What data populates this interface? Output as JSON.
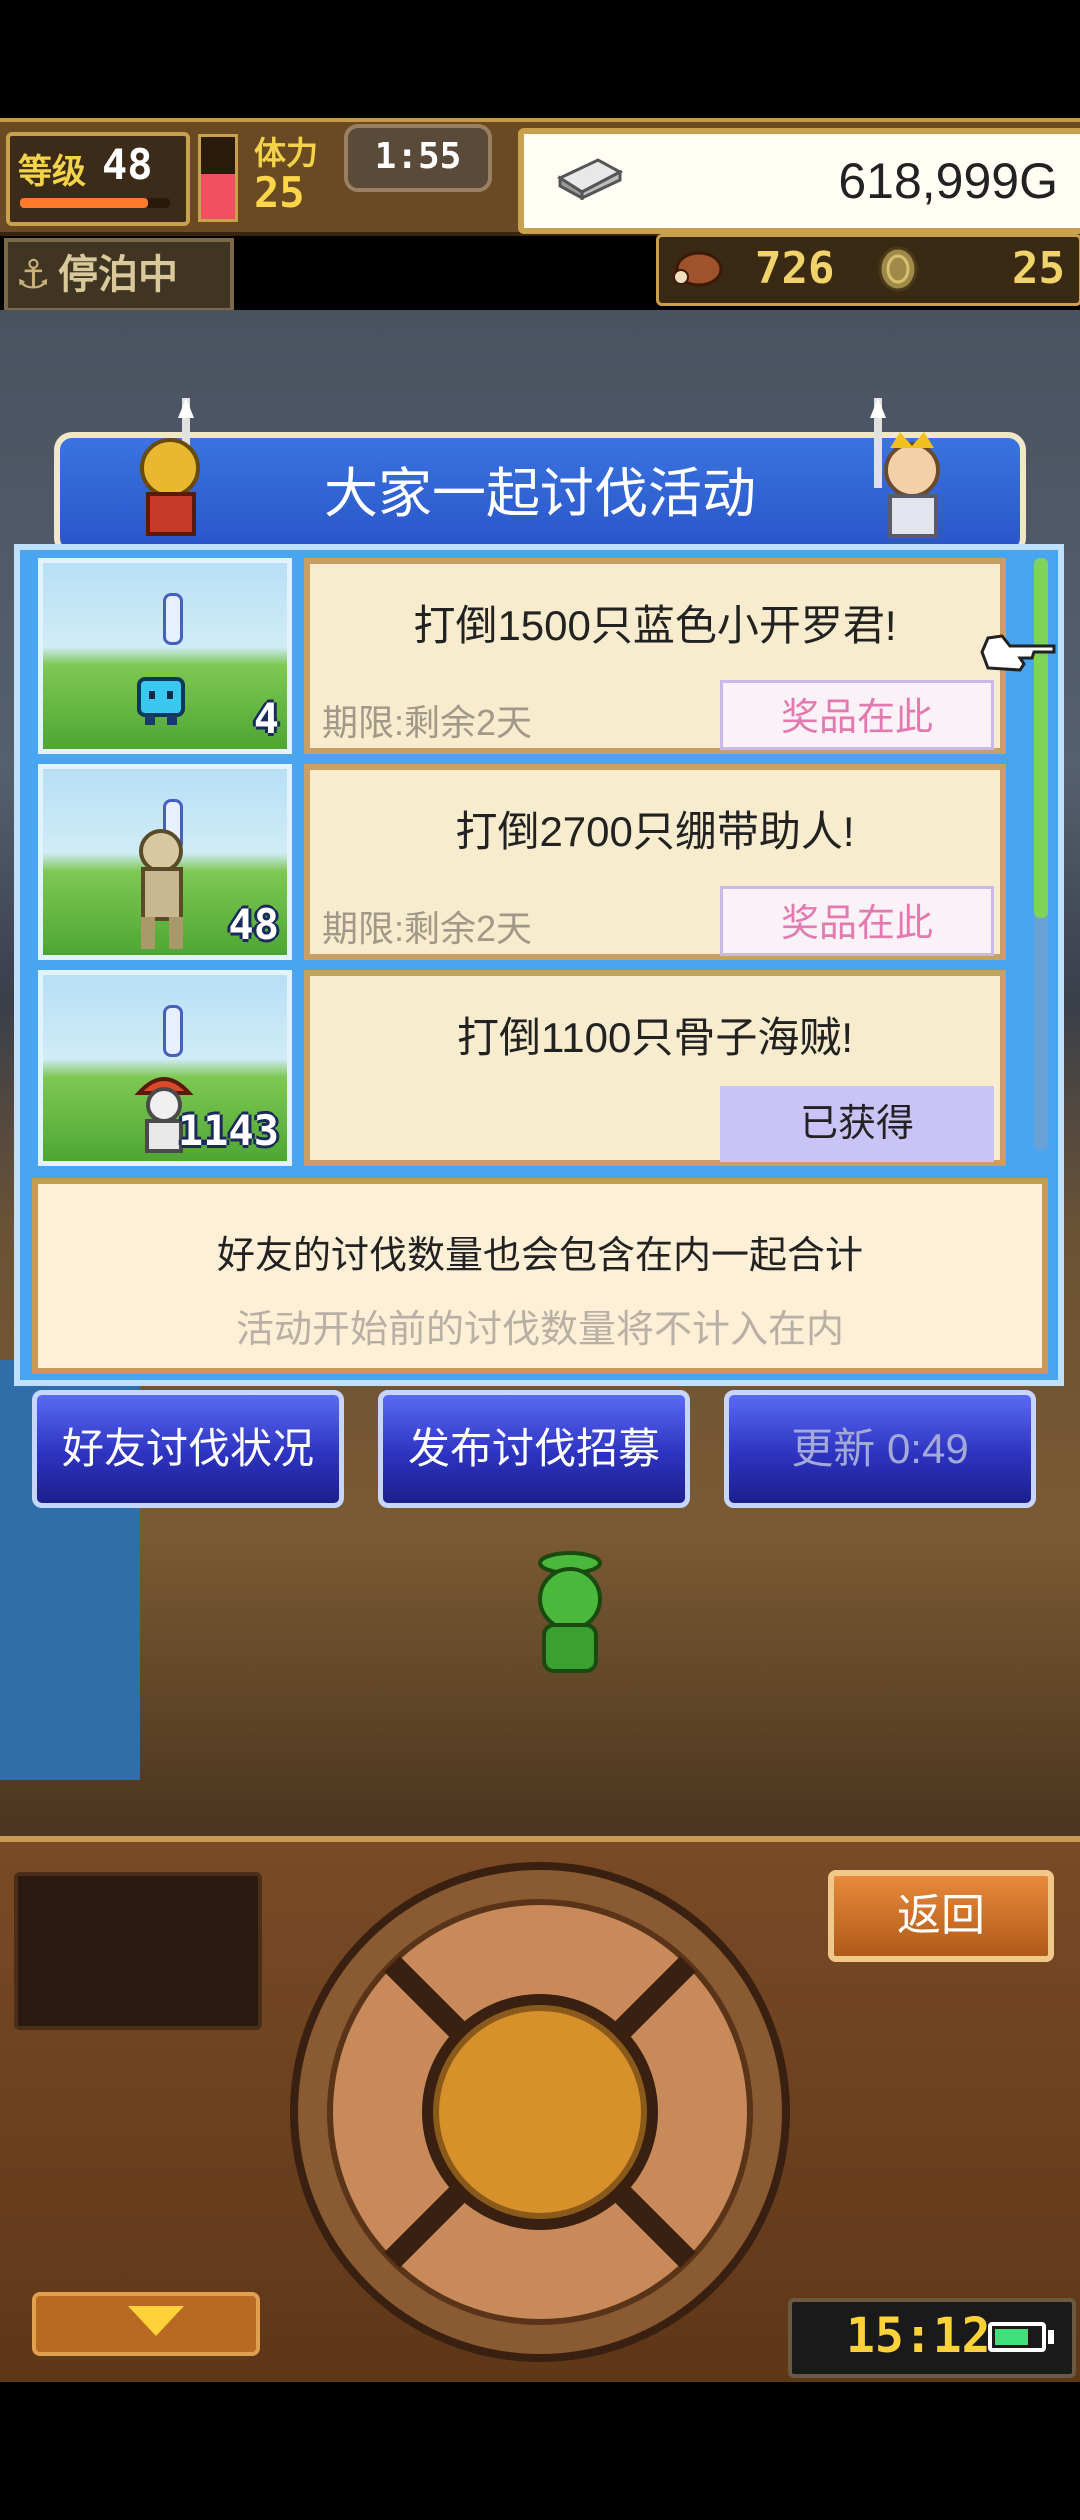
{
  "hud": {
    "level_label": "等级",
    "level_value": "48",
    "level_progress": 0.85,
    "stamina_label": "体力",
    "stamina_value": "25",
    "stamina_fill": 0.55,
    "timer": "1:55",
    "gold": "618,999G"
  },
  "status": {
    "docked_label": "停泊中",
    "resource1_value": "726",
    "resource2_value": "25"
  },
  "dialog": {
    "title": "大家一起讨伐活动",
    "quests": [
      {
        "title": "打倒1500只蓝色小开罗君!",
        "deadline": "期限:剩余2天",
        "button": "奖品在此",
        "thumb_count": "4"
      },
      {
        "title": "打倒2700只绷带助人!",
        "deadline": "期限:剩余2天",
        "button": "奖品在此",
        "thumb_count": "48"
      },
      {
        "title": "打倒1100只骨子海贼!",
        "deadline": "",
        "button": "已获得",
        "thumb_count": "1143"
      }
    ],
    "info_line1": "好友的讨伐数量也会包含在内一起合计",
    "info_line2": "活动开始前的讨伐数量将不计入在内"
  },
  "menu": {
    "friends_status": "好友讨伐状况",
    "post_recruit": "发布讨伐招募",
    "refresh": "更新 0:49"
  },
  "bottom": {
    "back_label": "返回",
    "clock": "15:12",
    "battery_level": 0.75
  },
  "colors": {
    "dialog_blue": "#4aa5f0",
    "reward_pink": "#e27ab0",
    "obtained_purple": "#c9c4f5",
    "button_blue": "#2d33c0"
  }
}
